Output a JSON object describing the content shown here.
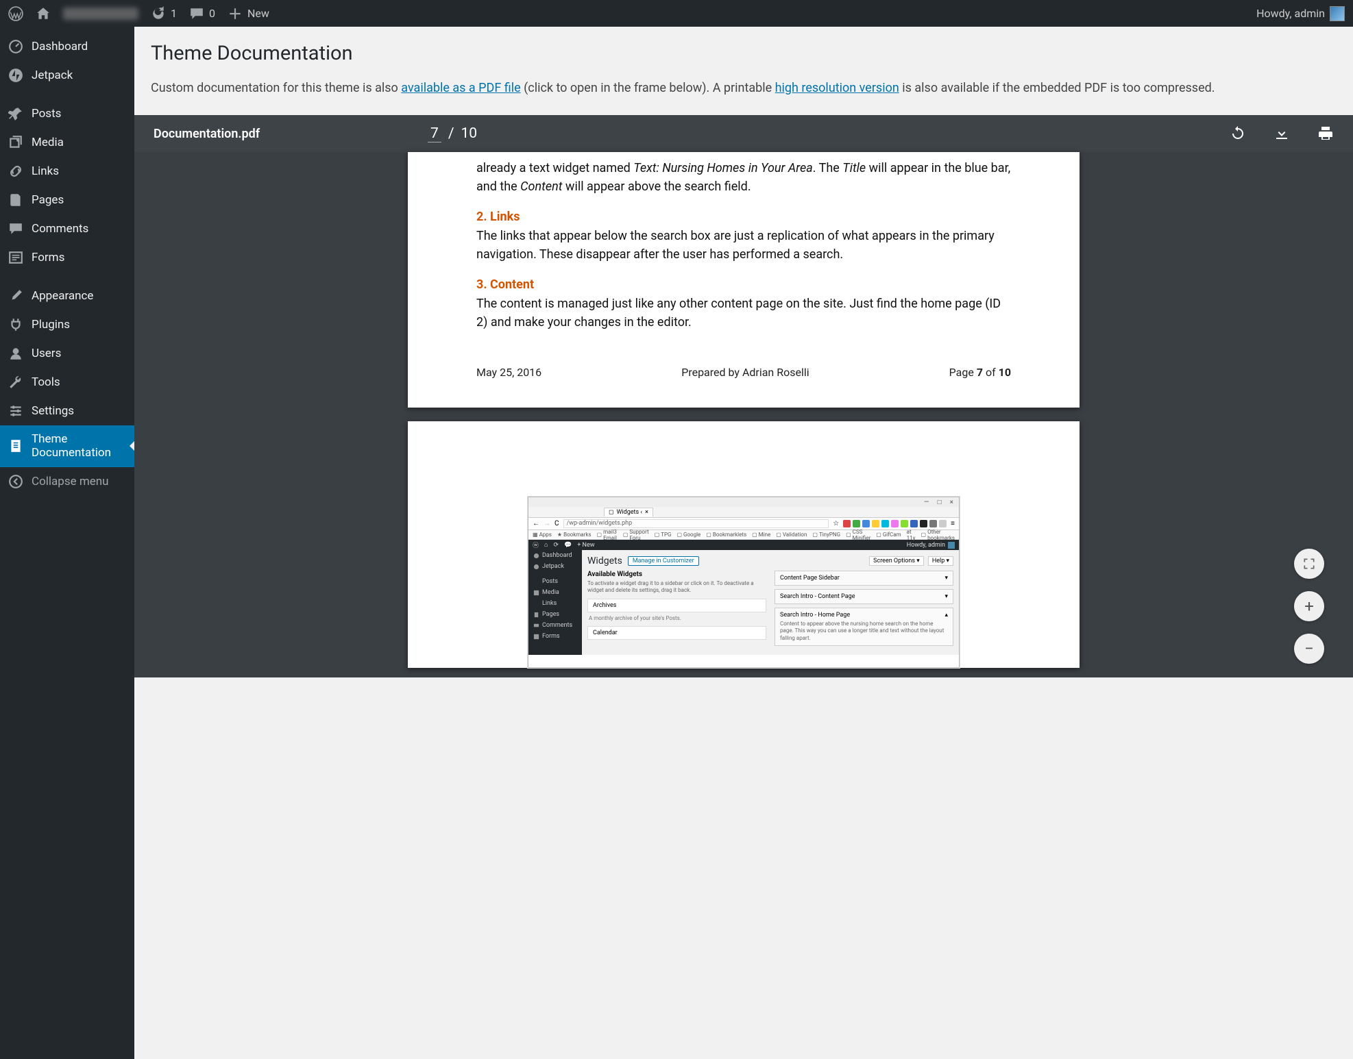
{
  "adminbar": {
    "updates_count": "1",
    "comments_count": "0",
    "new_label": "New",
    "howdy": "Howdy, admin"
  },
  "sidebar": {
    "items": [
      {
        "label": "Dashboard"
      },
      {
        "label": "Jetpack"
      },
      {
        "label": "Posts"
      },
      {
        "label": "Media"
      },
      {
        "label": "Links"
      },
      {
        "label": "Pages"
      },
      {
        "label": "Comments"
      },
      {
        "label": "Forms"
      },
      {
        "label": "Appearance"
      },
      {
        "label": "Plugins"
      },
      {
        "label": "Users"
      },
      {
        "label": "Tools"
      },
      {
        "label": "Settings"
      },
      {
        "label1": "Theme",
        "label2": "Documentation"
      }
    ],
    "collapse": "Collapse menu"
  },
  "header": {
    "title": "Theme Documentation",
    "intro_pre": "Custom documentation for this theme is also ",
    "link1": "available as a PDF file",
    "intro_mid": " (click to open in the frame below). A printable ",
    "link2": "high resolution version",
    "intro_post": " is also available if the embedded PDF is too compressed."
  },
  "pdf": {
    "filename": "Documentation.pdf",
    "page_current": "7",
    "page_sep": "/",
    "page_total": "10",
    "page7": {
      "p1_a": "already a text widget named ",
      "p1_em": "Text: Nursing Homes in Your Area",
      "p1_b": ". The ",
      "p1_em2": "Title",
      "p1_c": " will appear in the blue bar, and the ",
      "p1_em3": "Content",
      "p1_d": " will appear above the search field.",
      "h2": "2. Links",
      "p2": "The links that appear below the search box are just a replication of what appears in the primary navigation. These disappear after the user has performed a search.",
      "h3": "3. Content",
      "p3": "The content is managed just like any other content page on the site. Just find the home page (ID 2) and make your changes in the editor.",
      "footer_date": "May 25, 2016",
      "footer_author": "Prepared by Adrian Roselli",
      "footer_page_pre": "Page ",
      "footer_page_cur": "7",
      "footer_page_of": " of ",
      "footer_page_total": "10"
    },
    "mini": {
      "title_close": "×",
      "title_max": "□",
      "title_min": "—",
      "tab_label": "Widgets ‹",
      "tab_close": "×",
      "url": "/wp-admin/widgets.php",
      "bm_apps": "Apps",
      "bm_bookmarks": "Bookmarks",
      "bm_mail": "mail3 Email",
      "bm_support": "Support Foru",
      "bm_tpg": "TPG",
      "bm_google": "Google",
      "bm_bklets": "Bookmarklets",
      "bm_mine": "Mine",
      "bm_valid": "Validation",
      "bm_tiny": "TinyPNG",
      "bm_css": "CSS Minifier",
      "bm_gif": "GifCam",
      "bm_at11y": "at 11y",
      "bm_other": "Other bookmarks",
      "admin_new": "+ New",
      "admin_howdy": "Howdy, admin",
      "screen_options": "Screen Options ▾",
      "help": "Help ▾",
      "side_dashboard": "Dashboard",
      "side_jetpack": "Jetpack",
      "side_posts": "Posts",
      "side_media": "Media",
      "side_links": "Links",
      "side_pages": "Pages",
      "side_comments": "Comments",
      "side_forms": "Forms",
      "h_widgets": "Widgets",
      "btn_manage": "Manage in Customizer",
      "available": "Available Widgets",
      "available_desc": "To activate a widget drag it to a sidebar or click on it. To deactivate a widget and delete its settings, drag it back.",
      "box_archives": "Archives",
      "box_archives_desc": "A monthly archive of your site's Posts.",
      "box_calendar": "Calendar",
      "panel_content_sidebar": "Content Page Sidebar",
      "panel_search_content": "Search Intro - Content Page",
      "panel_search_home": "Search Intro - Home Page",
      "panel_search_home_desc": "Content to appear above the nursing home search on the home page. This way you can use a longer title and text without the layout falling apart."
    }
  }
}
